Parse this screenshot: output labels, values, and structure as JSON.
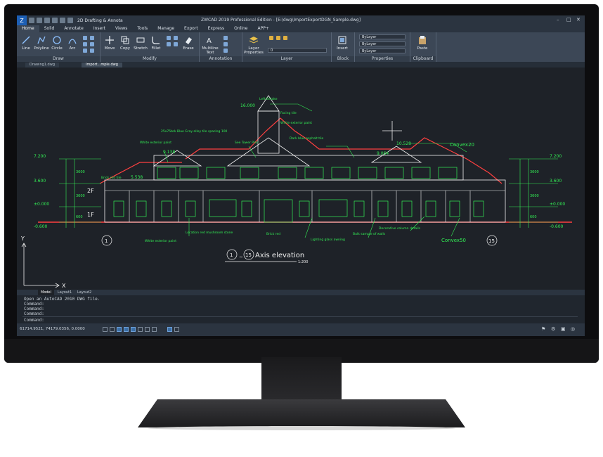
{
  "window": {
    "workspace": "2D Drafting & Annota",
    "title": "ZWCAD 2019 Professional Edition - [E:\\dwg\\ImportExportDGN_Sample.dwg]"
  },
  "ribbon_tabs": [
    "Home",
    "Solid",
    "Annotate",
    "Insert",
    "Views",
    "Tools",
    "Manage",
    "Export",
    "Express",
    "Online",
    "APP+"
  ],
  "ribbon": {
    "draw": {
      "label": "Draw",
      "tools": [
        "Line",
        "Polyline",
        "Circle",
        "Arc"
      ]
    },
    "modify": {
      "label": "Modify",
      "tools": [
        "Move",
        "Copy",
        "Stretch",
        "Fillet",
        "Erase"
      ]
    },
    "annotation": {
      "label": "Annotation",
      "tools": [
        "Multiline Text"
      ]
    },
    "layer": {
      "label": "Layer",
      "tools": [
        "Layer Properties"
      ],
      "current": "0"
    },
    "block": {
      "label": "Block",
      "tools": [
        "Insert"
      ]
    },
    "properties": {
      "label": "Properties",
      "color": "ByLayer",
      "linetype": "ByLayer",
      "lineweight": "ByLayer"
    },
    "clipboard": {
      "label": "Clipboard",
      "tools": [
        "Paste"
      ]
    }
  },
  "doc_tabs": [
    "Drawing1.dwg",
    "Import...mple.dwg"
  ],
  "drawing": {
    "title": "Axis elevation",
    "scale": "1:200",
    "axis_start": "1",
    "axis_end": "15",
    "floor_labels": [
      "2F",
      "1F"
    ],
    "elevations_left": [
      "7.200",
      "3.600",
      "±0.000",
      "-0.600"
    ],
    "elevations_right": [
      "7.200",
      "3.600",
      "±0.000",
      "-0.600"
    ],
    "dims_left": [
      "3600",
      "3600",
      "600"
    ],
    "dims_right": [
      "3600",
      "3600",
      "600"
    ],
    "top_marks": [
      "16.000",
      "9.138",
      "5.538",
      "10.528",
      "9.064"
    ],
    "annotations": [
      "Left Betake",
      "Facing tile",
      "White exterior paint",
      "25x75brk Blue Gray alloy tile spacing 100",
      "See Tower Plan",
      "Dark blue asphalt tile",
      "Convex20",
      "White exterior paint",
      "Brick red tile",
      "White exterior paint",
      "Brick red",
      "Lighting glass awning",
      "Bulk sample of walls",
      "Decorative column details",
      "Convex50",
      "Location red mushroom stone"
    ],
    "ucs": {
      "x": "X",
      "y": "Y"
    }
  },
  "layout_tabs": [
    "Model",
    "Layout1",
    "Layout2"
  ],
  "command_lines": [
    "Open an AutoCAD 2010 DWG file.",
    "Command:",
    "Command:",
    "Command:"
  ],
  "command_prompt": "Command:",
  "status": {
    "coords": "61714.9521, 74179.0356, 0.0000"
  },
  "colors": {
    "drawing_bg": "#1e2228",
    "red_lines": "#ff4040",
    "green": "#33ee55",
    "white": "#f0f0f0",
    "ribbon": "#3c4756"
  }
}
